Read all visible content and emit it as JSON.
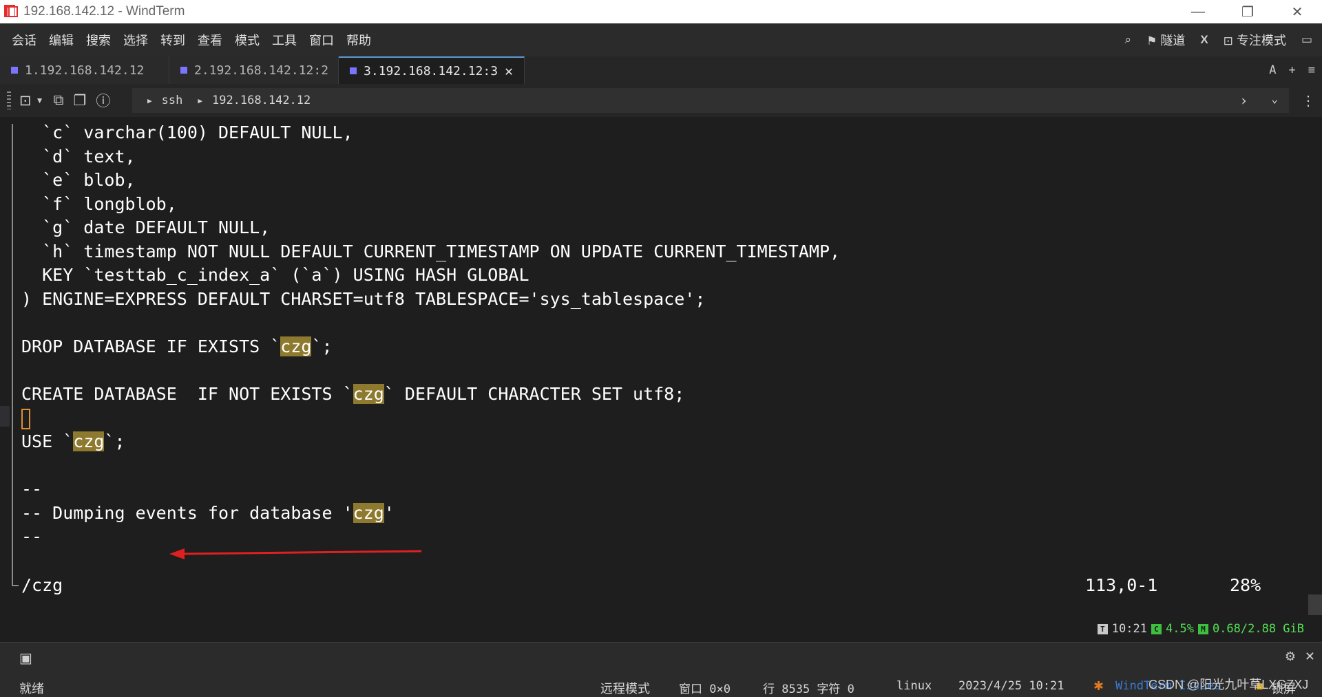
{
  "window": {
    "title": "192.168.142.12 - WindTerm",
    "controls": [
      "—",
      "❐",
      "✕"
    ]
  },
  "menu": {
    "items": [
      "会话",
      "编辑",
      "搜索",
      "选择",
      "转到",
      "查看",
      "模式",
      "工具",
      "窗口",
      "帮助"
    ],
    "right": {
      "tunnel": "隧道",
      "focus_mode": "专注模式"
    }
  },
  "tabs": [
    {
      "label": "1.192.168.142.12"
    },
    {
      "label": "2.192.168.142.12:2"
    },
    {
      "label": "3.192.168.142.12:3"
    }
  ],
  "tab_right": {
    "font_label": "A",
    "add": "+",
    "menu": "≡"
  },
  "address": {
    "protocol": "ssh",
    "host": "192.168.142.12"
  },
  "terminal": {
    "lines": [
      {
        "segments": [
          {
            "t": "  `c` varchar(100) DEFAULT NULL,"
          }
        ]
      },
      {
        "segments": [
          {
            "t": "  `d` text,"
          }
        ]
      },
      {
        "segments": [
          {
            "t": "  `e` blob,"
          }
        ]
      },
      {
        "segments": [
          {
            "t": "  `f` longblob,"
          }
        ]
      },
      {
        "segments": [
          {
            "t": "  `g` date DEFAULT NULL,"
          }
        ]
      },
      {
        "segments": [
          {
            "t": "  `h` timestamp NOT NULL DEFAULT CURRENT_TIMESTAMP ON UPDATE CURRENT_TIMESTAMP,"
          }
        ]
      },
      {
        "segments": [
          {
            "t": "  KEY `testtab_c_index_a` (`a`) USING HASH GLOBAL"
          }
        ]
      },
      {
        "segments": [
          {
            "t": ") ENGINE=EXPRESS DEFAULT CHARSET=utf8 TABLESPACE='sys_tablespace';"
          }
        ]
      },
      {
        "segments": []
      },
      {
        "segments": [
          {
            "t": "DROP DATABASE IF EXISTS `"
          },
          {
            "t": "czg",
            "hl": true
          },
          {
            "t": "`;"
          }
        ]
      },
      {
        "segments": []
      },
      {
        "segments": [
          {
            "t": "CREATE DATABASE  IF NOT EXISTS `"
          },
          {
            "t": "czg",
            "hl": true
          },
          {
            "t": "` DEFAULT CHARACTER SET utf8;"
          }
        ]
      },
      {
        "segments": [],
        "cursor": true
      },
      {
        "segments": [
          {
            "t": "USE `"
          },
          {
            "t": "czg",
            "hl": true
          },
          {
            "t": "`;"
          }
        ]
      },
      {
        "segments": []
      },
      {
        "segments": [
          {
            "t": "--"
          }
        ]
      },
      {
        "segments": [
          {
            "t": "-- Dumping events for database '"
          },
          {
            "t": "czg",
            "hl": true
          },
          {
            "t": "'"
          }
        ]
      },
      {
        "segments": [
          {
            "t": "--"
          }
        ]
      }
    ],
    "vim_status": {
      "command": "/czg",
      "position": "113,0-1",
      "percent": "28%"
    },
    "arrow_color": "#e02020",
    "highlight_color": "#8e7a2e"
  },
  "sysinfo": {
    "time_badge": "T",
    "time": "10:21",
    "cpu_badge": "C",
    "cpu": "4.5%",
    "mem_badge": "M",
    "mem": "0.68/2.88 GiB"
  },
  "statusbar": {
    "ready": "就绪",
    "remote_mode": "远程模式",
    "window_size": "窗口 0×0",
    "line_char": "行 8535 字符 0",
    "os": "linux",
    "datetime": "2023/4/25 10:21",
    "brand": "WindTerm Issues",
    "lock": "锁屏",
    "watermark": "CSDN @阳光九叶草LXGZXJ"
  }
}
